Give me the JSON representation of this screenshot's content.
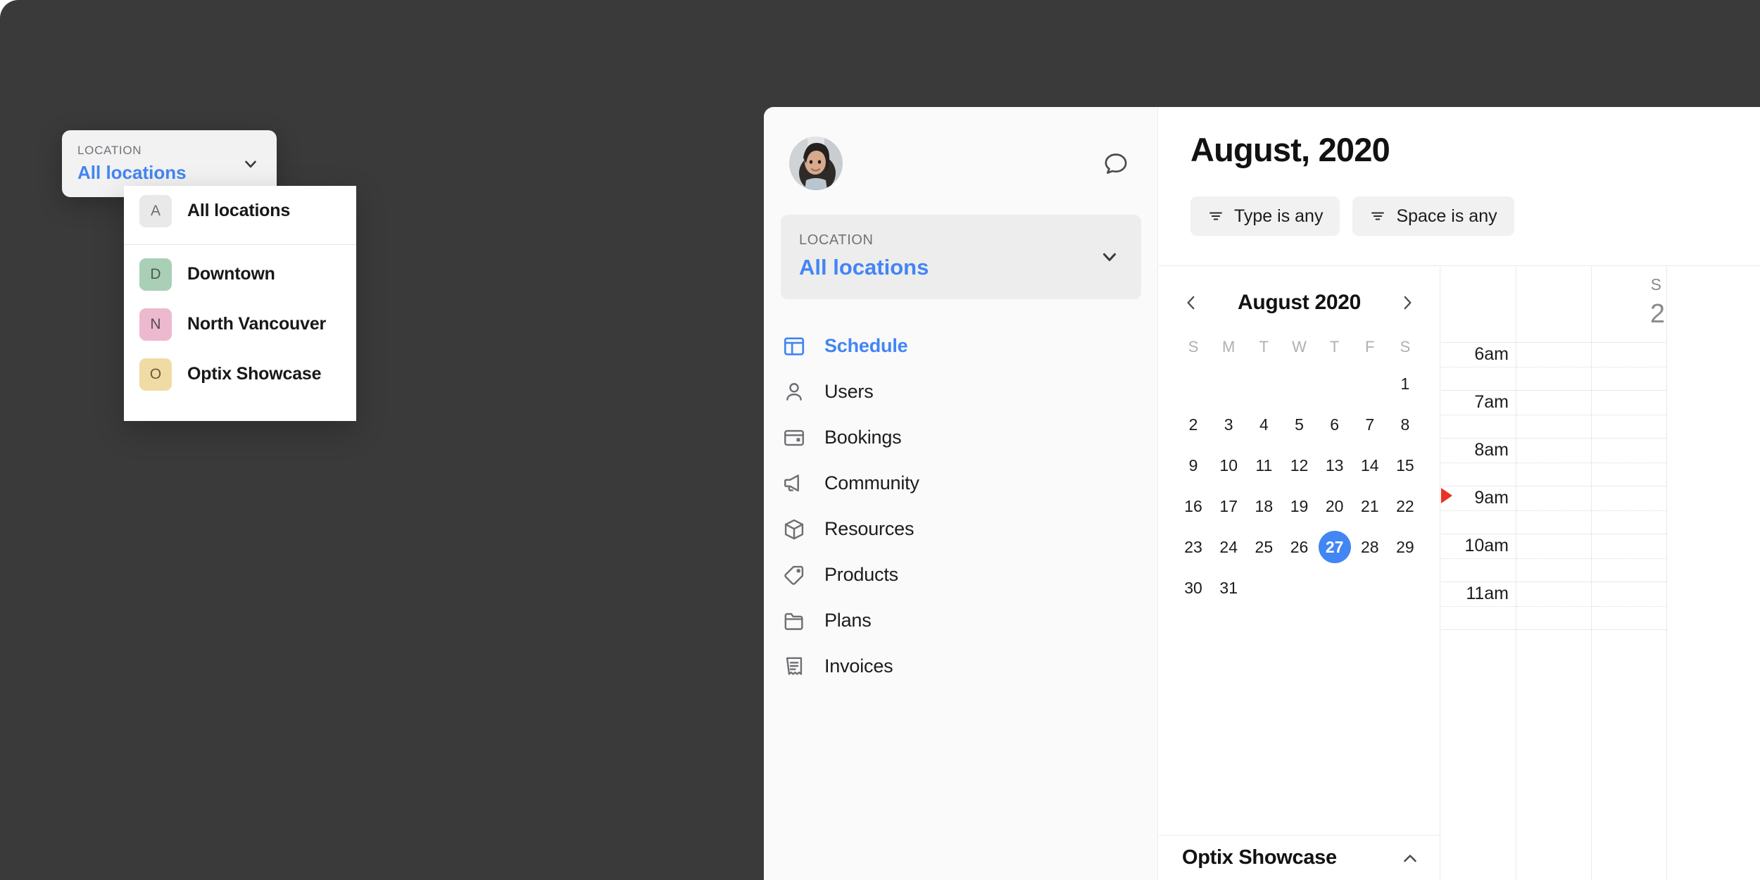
{
  "theme": {
    "backdrop": "#3a3a3a",
    "accent": "#4285f4",
    "sidebar_bg": "#fafafa",
    "card_bg": "#ededed",
    "now_marker": "#ea3323"
  },
  "sidebar": {
    "avatar": "user-avatar-photo",
    "chat_icon": "chat-bubble-icon",
    "location": {
      "label": "LOCATION",
      "value": "All locations",
      "chevron": "chevron-down-icon"
    },
    "items": [
      {
        "label": "Schedule",
        "icon": "layout-dashboard-icon",
        "active": true
      },
      {
        "label": "Users",
        "icon": "user-icon",
        "active": false
      },
      {
        "label": "Bookings",
        "icon": "card-window-icon",
        "active": false
      },
      {
        "label": "Community",
        "icon": "megaphone-icon",
        "active": false
      },
      {
        "label": "Resources",
        "icon": "box-cube-icon",
        "active": false
      },
      {
        "label": "Products",
        "icon": "price-tag-icon",
        "active": false
      },
      {
        "label": "Plans",
        "icon": "folder-icon",
        "active": false
      },
      {
        "label": "Invoices",
        "icon": "invoice-receipt-icon",
        "active": false
      }
    ]
  },
  "main": {
    "page_title": "August, 2020",
    "filters": [
      {
        "label": "Type is any",
        "icon": "filter-icon"
      },
      {
        "label": "Space is any",
        "icon": "filter-icon"
      }
    ]
  },
  "calendar": {
    "prev_icon": "chevron-left-icon",
    "next_icon": "chevron-right-icon",
    "month_label": "August 2020",
    "dow": [
      "S",
      "M",
      "T",
      "W",
      "T",
      "F",
      "S"
    ],
    "leading_blanks": 6,
    "days": [
      1,
      2,
      3,
      4,
      5,
      6,
      7,
      8,
      9,
      10,
      11,
      12,
      13,
      14,
      15,
      16,
      17,
      18,
      19,
      20,
      21,
      22,
      23,
      24,
      25,
      26,
      27,
      28,
      29,
      30,
      31
    ],
    "selected_day": 27,
    "footer": {
      "label": "Optix Showcase",
      "chevron": "chevron-up-icon"
    }
  },
  "time_grid": {
    "hours": [
      "6am",
      "7am",
      "8am",
      "9am",
      "10am",
      "11am"
    ],
    "now_marker": "current-time-indicator",
    "columns": [
      {
        "dow": "",
        "num": ""
      },
      {
        "dow": "S",
        "num": "2"
      }
    ]
  },
  "floating_location_card": {
    "label": "LOCATION",
    "value": "All locations",
    "chevron": "chevron-down-icon"
  },
  "location_dropdown": {
    "items": [
      {
        "badge": "A",
        "label": "All locations",
        "badge_bg": "#e9e9e9",
        "badge_fg": "#6e6e73"
      },
      {
        "badge": "D",
        "label": "Downtown",
        "badge_bg": "#a9cfb6",
        "badge_fg": "#4a5a50"
      },
      {
        "badge": "N",
        "label": "North Vancouver",
        "badge_bg": "#edb9cf",
        "badge_fg": "#5a4a52"
      },
      {
        "badge": "O",
        "label": "Optix Showcase",
        "badge_bg": "#f0dba4",
        "badge_fg": "#6a5a3a"
      }
    ]
  }
}
